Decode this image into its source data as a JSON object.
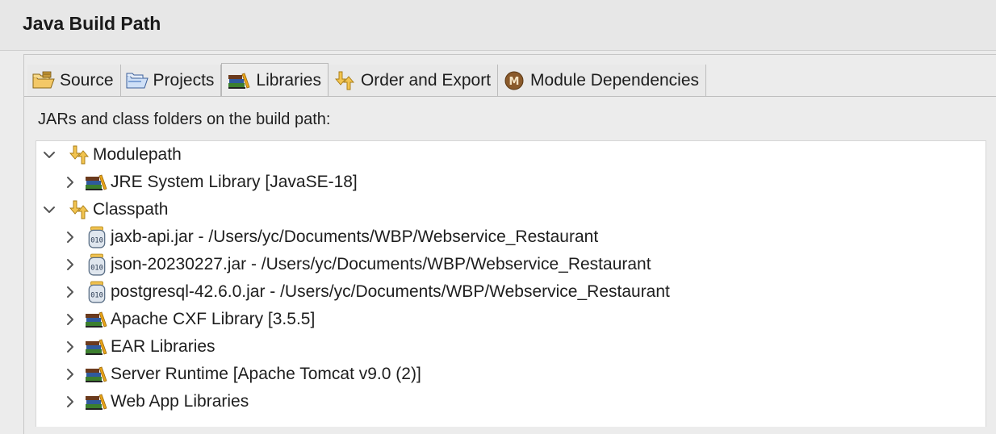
{
  "header": {
    "title": "Java Build Path"
  },
  "tabs": [
    {
      "label": "Source",
      "icon": "source-folder-icon",
      "active": false
    },
    {
      "label": "Projects",
      "icon": "projects-icon",
      "active": false
    },
    {
      "label": "Libraries",
      "icon": "library-books-icon",
      "active": true
    },
    {
      "label": "Order and Export",
      "icon": "order-arrows-icon",
      "active": false
    },
    {
      "label": "Module Dependencies",
      "icon": "module-m-icon",
      "active": false
    }
  ],
  "content": {
    "label": "JARs and class folders on the build path:"
  },
  "tree": {
    "modulepath": {
      "label": "Modulepath",
      "expanded": true,
      "children": [
        {
          "label": "JRE System Library [JavaSE-18]",
          "icon": "library-books-icon"
        }
      ]
    },
    "classpath": {
      "label": "Classpath",
      "expanded": true,
      "children": [
        {
          "label": "jaxb-api.jar - /Users/yc/Documents/WBP/Webservice_Restaurant",
          "icon": "jar-file-icon"
        },
        {
          "label": "json-20230227.jar - /Users/yc/Documents/WBP/Webservice_Restaurant",
          "icon": "jar-file-icon"
        },
        {
          "label": "postgresql-42.6.0.jar - /Users/yc/Documents/WBP/Webservice_Restaurant",
          "icon": "jar-file-icon"
        },
        {
          "label": "Apache CXF Library [3.5.5]",
          "icon": "library-books-icon"
        },
        {
          "label": "EAR Libraries",
          "icon": "library-books-icon"
        },
        {
          "label": "Server Runtime [Apache Tomcat v9.0 (2)]",
          "icon": "library-books-icon"
        },
        {
          "label": "Web App Libraries",
          "icon": "library-books-icon"
        }
      ]
    }
  },
  "colors": {
    "background": "#ececec",
    "tree_bg": "#ffffff",
    "accent_orange": "#e8a317"
  }
}
